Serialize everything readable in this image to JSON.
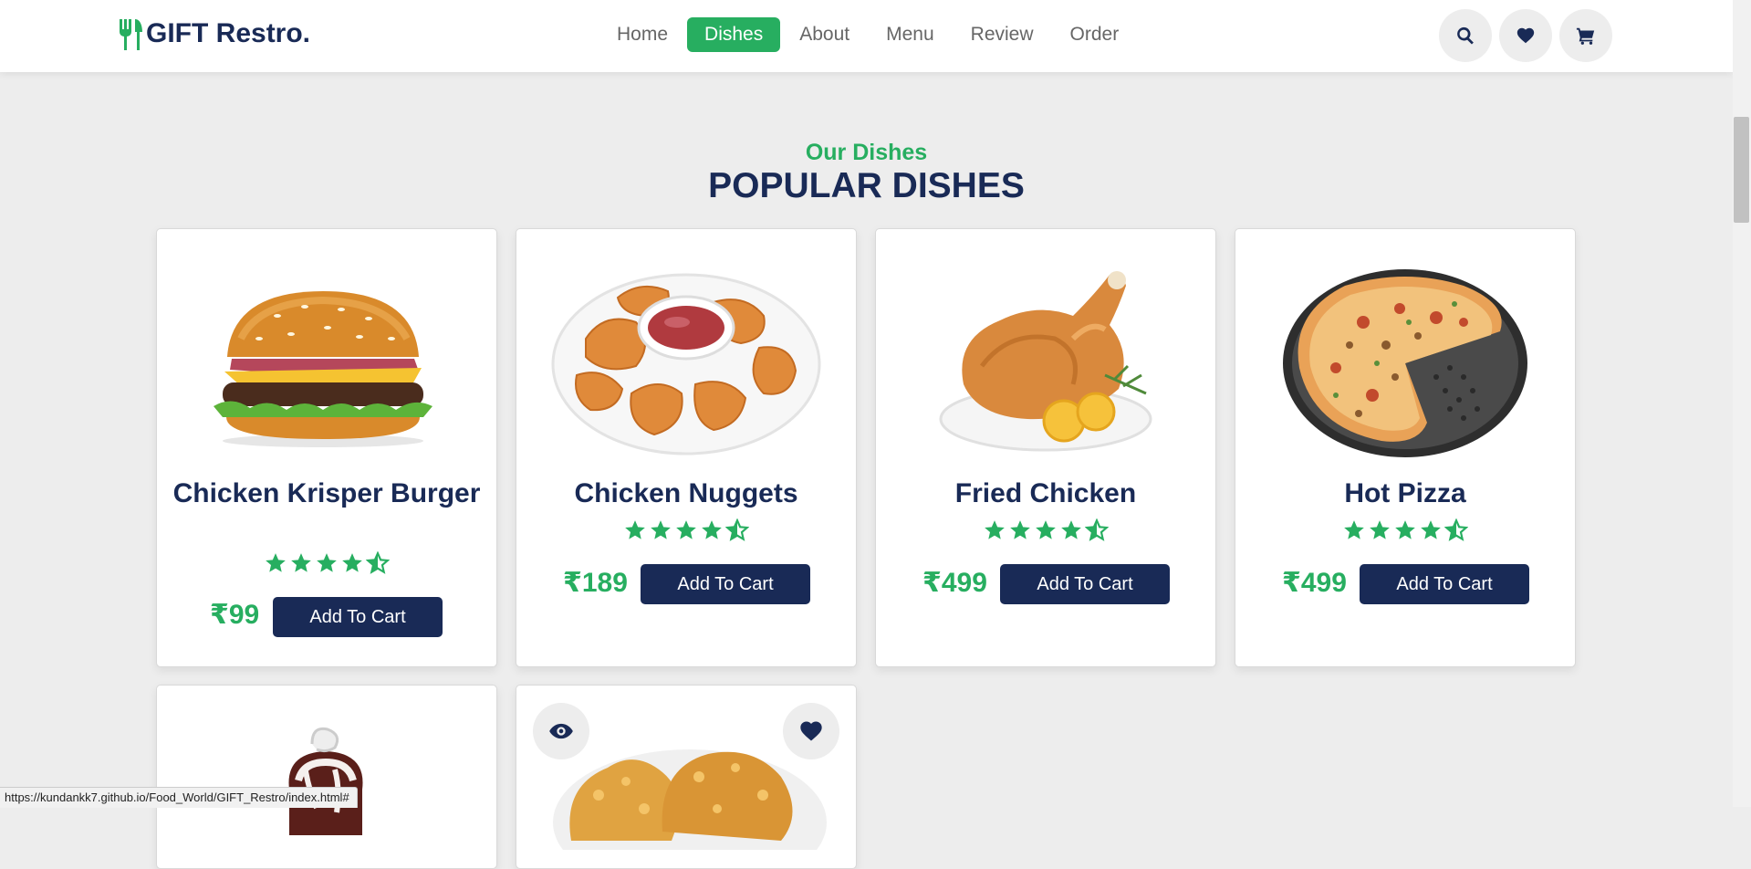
{
  "header": {
    "logo_text": "GIFT Restro.",
    "nav": [
      {
        "label": "Home",
        "active": false
      },
      {
        "label": "Dishes",
        "active": true
      },
      {
        "label": "About",
        "active": false
      },
      {
        "label": "Menu",
        "active": false
      },
      {
        "label": "Review",
        "active": false
      },
      {
        "label": "Order",
        "active": false
      }
    ],
    "icons": [
      "search-icon",
      "heart-icon",
      "shopping-cart-icon"
    ]
  },
  "section": {
    "sub_heading": "Our Dishes",
    "heading": "POPULAR DISHES"
  },
  "dishes": [
    {
      "name": "Chicken Krisper Burger",
      "rating": 4.5,
      "price": "₹99",
      "button": "Add To Cart"
    },
    {
      "name": "Chicken Nuggets",
      "rating": 4.5,
      "price": "₹189",
      "button": "Add To Cart"
    },
    {
      "name": "Fried Chicken",
      "rating": 4.5,
      "price": "₹499",
      "button": "Add To Cart"
    },
    {
      "name": "Hot Pizza",
      "rating": 4.5,
      "price": "₹499",
      "button": "Add To Cart"
    }
  ],
  "partial_cards": [
    {
      "image": "dessert-image"
    },
    {
      "image": "fried-chicken-image",
      "icons": [
        "eye-icon",
        "heart-icon"
      ]
    }
  ],
  "status_bar": {
    "url": "https://kundankk7.github.io/Food_World/GIFT_Restro/index.html#"
  },
  "colors": {
    "accent": "#27ae60",
    "navy": "#192a56",
    "background": "#ededed"
  }
}
